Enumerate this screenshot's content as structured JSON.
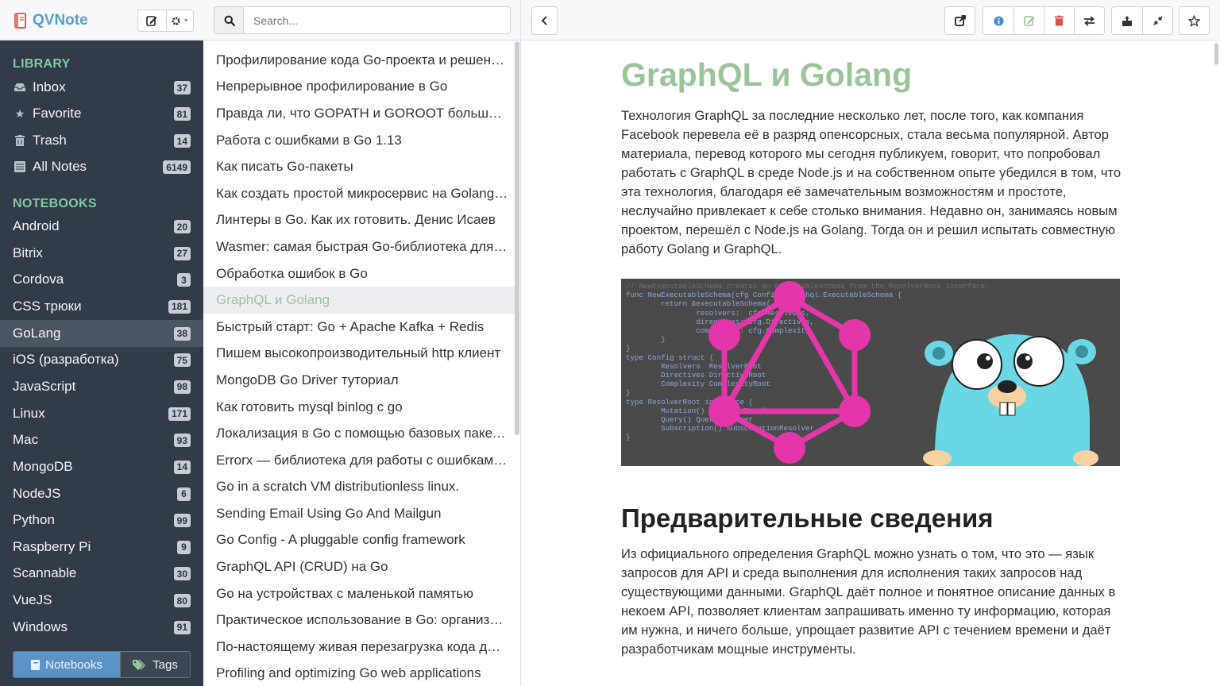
{
  "app": {
    "title": "QVNote"
  },
  "sidebar": {
    "library_heading": "LIBRARY",
    "library": [
      {
        "label": "Inbox",
        "count": "37",
        "icon": "inbox-icon"
      },
      {
        "label": "Favorite",
        "count": "81",
        "icon": "star-icon"
      },
      {
        "label": "Trash",
        "count": "14",
        "icon": "trash-icon"
      },
      {
        "label": "All Notes",
        "count": "6149",
        "icon": "notes-icon"
      }
    ],
    "notebooks_heading": "NOTEBOOKS",
    "notebooks": [
      {
        "label": "Android",
        "count": "20"
      },
      {
        "label": "Bitrix",
        "count": "27"
      },
      {
        "label": "Cordova",
        "count": "3"
      },
      {
        "label": "CSS трюки",
        "count": "181"
      },
      {
        "label": "GoLang",
        "count": "38",
        "active": true
      },
      {
        "label": "iOS (разработка)",
        "count": "75"
      },
      {
        "label": "JavaScript",
        "count": "98"
      },
      {
        "label": "Linux",
        "count": "171"
      },
      {
        "label": "Mac",
        "count": "93"
      },
      {
        "label": "MongoDB",
        "count": "14"
      },
      {
        "label": "NodeJS",
        "count": "6"
      },
      {
        "label": "Python",
        "count": "99"
      },
      {
        "label": "Raspberry Pi",
        "count": "9"
      },
      {
        "label": "Scannable",
        "count": "30"
      },
      {
        "label": "VueJS",
        "count": "80"
      },
      {
        "label": "Windows",
        "count": "91"
      }
    ],
    "tabs": {
      "notebooks": "Notebooks",
      "tags": "Tags"
    }
  },
  "search": {
    "placeholder": "Search..."
  },
  "notes": [
    "Профилирование кода Go-проекта и решение проблем",
    "Непрерывное профилирование в Go",
    "Правда ли, что GOPATH и GOROOT больше не нужны?",
    "Работа с ошибками в Go 1.13",
    "Как писать Go-пакеты",
    "Как создать простой микросервис на Golang и gRPC",
    "Линтеры в Go. Как их готовить. Денис Исаев",
    "Wasmer: самая быстрая Go-библиотека для выполнения WebAssembly",
    "Обработка ошибок в Go",
    "GraphQL и Golang",
    "Быстрый старт: Go + Apache Kafka + Redis",
    "Пишем высокопроизводительный http клиент",
    "MongoDB Go Driver туториал",
    "Как готовить mysql binlog с go",
    "Локализация в Go с помощью базовых пакетов",
    "Errorx — библиотека для работы с ошибками в Go",
    "Go in a scratch VM distributionless linux.",
    "Sending Email Using Go And Mailgun",
    "Go Config - A pluggable config framework",
    "GraphQL API (CRUD) на Go",
    "Go на устройствах с маленькой памятью",
    "Практическое использование в Go: организация доступа к базам данных",
    "По-настоящему живая перезагрузка кода для Go",
    "Profiling and optimizing Go web applications"
  ],
  "active_note_index": 9,
  "article": {
    "title": "GraphQL и Golang",
    "intro": "Технология GraphQL за последние несколько лет, после того, как компания Facebook перевела её в разряд опенсорсных, стала весьма популярной. Автор материала, перевод которого мы сегодня публикуем, говорит, что попробовал работать с GraphQL в среде Node.js и на собственном опыте убедился в том, что эта технология, благодаря её замечательным возможностям и простоте, неслучайно привлекает к себе столько внимания. Недавно он, занимаясь новым проектом, перешёл с Node.js на Golang. Тогда он и решил испытать совместную работу Golang и GraphQL.",
    "h2": "Предварительные сведения",
    "para2": "Из официального определения GraphQL можно узнать о том, что это — язык запросов для API и среда выполнения для исполнения таких запросов над существующими данными. GraphQL даёт полное и понятное описание данных в некоем API, позволяет клиентам запрашивать именно ту информацию, которая им нужна, и ничего больше, упрощает развитие API с течением времени и даёт разработчикам мощные инструменты.",
    "code_lines": [
      "// NewExecutableSchema creates an ExecutableSchema from the ResolverRoot interface.",
      "func NewExecutableSchema(cfg Config) graphql.ExecutableSchema {",
      "        return &executableSchema{",
      "                resolvers:  cfg.Resolvers,",
      "                directives: cfg.Directives,",
      "                complexity: cfg.Complexity,",
      "        }",
      "}",
      "",
      "type Config struct {",
      "        Resolvers  ResolverRoot",
      "        Directives DirectiveRoot",
      "        Complexity ComplexityRoot",
      "}",
      "",
      "type ResolverRoot interface {",
      "        Mutation() MutationResolver",
      "        Query() QueryResolver",
      "        Subscription() SubscriptionResolver",
      "}"
    ]
  },
  "colors": {
    "sidebar_bg": "#323c48",
    "accent_green": "#9cc49a",
    "section_green": "#7ec8a0",
    "logo_blue": "#5b9bd5",
    "graphql_pink": "#e535ab",
    "gopher_blue": "#6ad7e5"
  }
}
